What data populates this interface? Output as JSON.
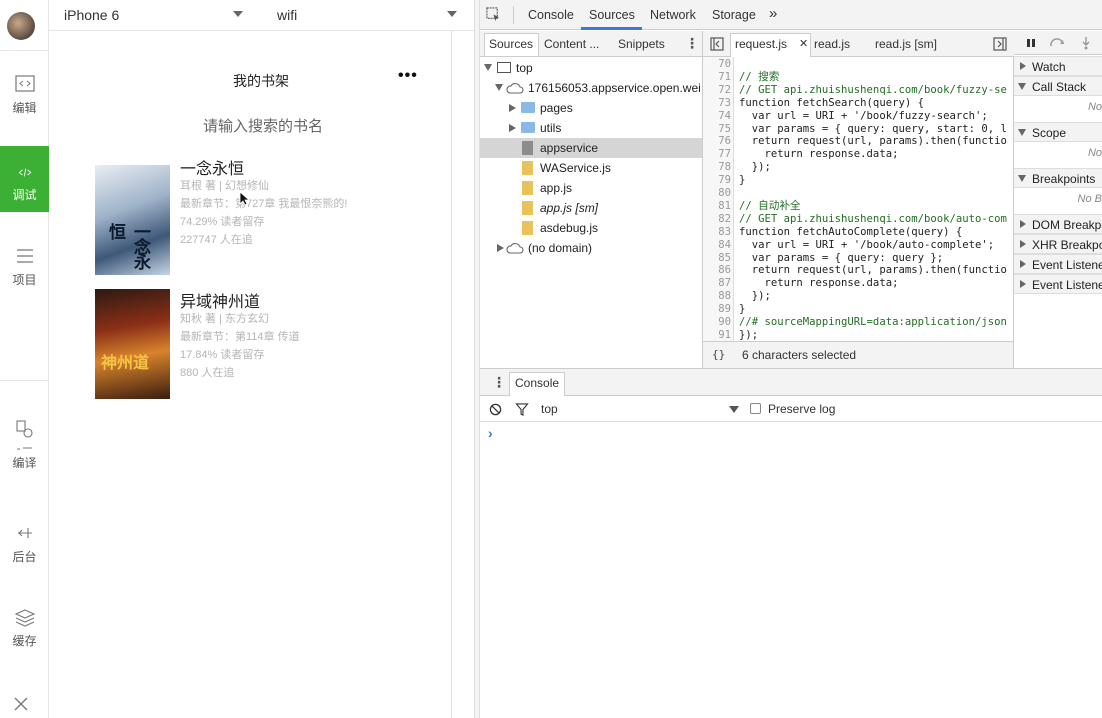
{
  "rail": {
    "items": [
      {
        "label": "编辑",
        "icon": "code-window-icon"
      },
      {
        "label": "调试",
        "icon": "debug-icon"
      },
      {
        "label": "项目",
        "icon": "menu-lines-icon"
      },
      {
        "label": "编译",
        "icon": "compile-icon"
      },
      {
        "label": "后台",
        "icon": "background-icon"
      },
      {
        "label": "缓存",
        "icon": "layers-icon"
      }
    ],
    "active_index": 1
  },
  "device_bar": {
    "device": "iPhone 6",
    "network": "wifi"
  },
  "phone": {
    "nav_title": "我的书架",
    "more_label": "•••",
    "search_placeholder": "请输入搜索的书名",
    "books": [
      {
        "title": "一念永恒",
        "author_line": "耳根 著 | 幻想修仙",
        "latest_line": "最新章节：第727章 我最恨奈熊的!",
        "retention": "74.29% 读者留存",
        "readers": "227747 人在追",
        "cover_text": "一念永恒"
      },
      {
        "title": "异域神州道",
        "author_line": "知秋 著 | 东方玄幻",
        "latest_line": "最新章节：第114章 传道",
        "retention": "17.84% 读者留存",
        "readers": "880 人在追",
        "cover_text": "神州道"
      }
    ]
  },
  "devtools": {
    "main_tabs": [
      "Console",
      "Sources",
      "Network",
      "Storage"
    ],
    "active_tab": "Sources",
    "more_tabs": "»",
    "navigator_tabs": [
      "Sources",
      "Content ...",
      "Snippets"
    ],
    "editor_tabs": [
      "request.js",
      "read.js",
      "read.js [sm]"
    ],
    "tree": [
      {
        "label": "top",
        "indent": 0,
        "kind": "frame",
        "expanded": true
      },
      {
        "label": "176156053.appservice.open.wei",
        "indent": 1,
        "kind": "cloud",
        "expanded": true
      },
      {
        "label": "pages",
        "indent": 2,
        "kind": "folder",
        "expanded": false
      },
      {
        "label": "utils",
        "indent": 2,
        "kind": "folder",
        "expanded": false
      },
      {
        "label": "appservice",
        "indent": 2,
        "kind": "file-grey",
        "selected": true
      },
      {
        "label": "WAService.js",
        "indent": 2,
        "kind": "file"
      },
      {
        "label": "app.js",
        "indent": 2,
        "kind": "file"
      },
      {
        "label": "app.js [sm]",
        "indent": 2,
        "kind": "file",
        "italic": true
      },
      {
        "label": "asdebug.js",
        "indent": 2,
        "kind": "file"
      },
      {
        "label": "(no domain)",
        "indent": 1,
        "kind": "cloud",
        "expanded": false
      }
    ],
    "code": [
      {
        "n": "70",
        "t": ""
      },
      {
        "n": "71",
        "t": "// 搜索",
        "c": "comment"
      },
      {
        "n": "72",
        "t": "// GET api.zhuishushenqi.com/book/fuzzy-se",
        "c": "comment"
      },
      {
        "n": "73",
        "t": "function fetchSearch(query) {"
      },
      {
        "n": "74",
        "t": "  var url = URI + '/book/fuzzy-search';"
      },
      {
        "n": "75",
        "t": "  var params = { query: query, start: 0, l"
      },
      {
        "n": "76",
        "t": "  return request(url, params).then(functio"
      },
      {
        "n": "77",
        "t": "    return response.data;"
      },
      {
        "n": "78",
        "t": "  });"
      },
      {
        "n": "79",
        "t": "}"
      },
      {
        "n": "80",
        "t": ""
      },
      {
        "n": "81",
        "t": "// 自动补全",
        "c": "comment"
      },
      {
        "n": "82",
        "t": "// GET api.zhuishushenqi.com/book/auto-com",
        "c": "comment"
      },
      {
        "n": "83",
        "t": "function fetchAutoComplete(query) {"
      },
      {
        "n": "84",
        "t": "  var url = URI + '/book/auto-complete';"
      },
      {
        "n": "85",
        "t": "  var params = { query: query };"
      },
      {
        "n": "86",
        "t": "  return request(url, params).then(functio"
      },
      {
        "n": "87",
        "t": "    return response.data;"
      },
      {
        "n": "88",
        "t": "  });"
      },
      {
        "n": "89",
        "t": "}"
      },
      {
        "n": "90",
        "t": "//# sourceMappingURL=data:application/json",
        "c": "comment"
      },
      {
        "n": "91",
        "t": "});"
      }
    ],
    "status_text": "6 characters selected",
    "status_icon": "{}",
    "debug_sections": [
      {
        "label": "Watch",
        "expanded": false
      },
      {
        "label": "Call Stack",
        "expanded": true,
        "empty": "No"
      },
      {
        "label": "Scope",
        "expanded": true,
        "empty": "No"
      },
      {
        "label": "Breakpoints",
        "expanded": true,
        "empty": "No B"
      },
      {
        "label": "DOM Breakpo",
        "expanded": false
      },
      {
        "label": "XHR Breakpo",
        "expanded": false
      },
      {
        "label": "Event Listene",
        "expanded": false
      },
      {
        "label": "Event Listene",
        "expanded": false
      }
    ],
    "console": {
      "tab": "Console",
      "context": "top",
      "preserve_log": "Preserve log",
      "prompt": "›"
    }
  }
}
